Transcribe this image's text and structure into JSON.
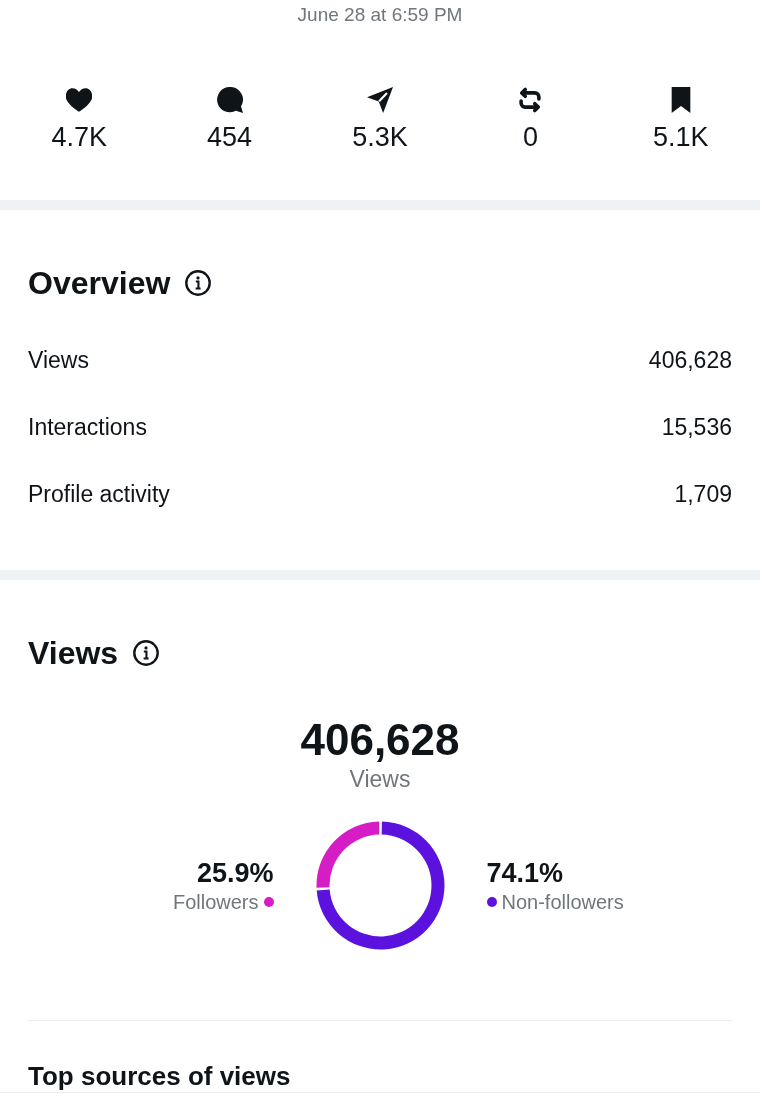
{
  "timestamp": "June 28 at 6:59 PM",
  "stats": [
    {
      "kind": "likes",
      "value": "4.7K"
    },
    {
      "kind": "comments",
      "value": "454"
    },
    {
      "kind": "shares",
      "value": "5.3K"
    },
    {
      "kind": "reposts",
      "value": "0"
    },
    {
      "kind": "saves",
      "value": "5.1K"
    }
  ],
  "overview": {
    "title": "Overview",
    "rows": [
      {
        "label": "Views",
        "value": "406,628"
      },
      {
        "label": "Interactions",
        "value": "15,536"
      },
      {
        "label": "Profile activity",
        "value": "1,709"
      }
    ]
  },
  "views": {
    "title": "Views",
    "total": "406,628",
    "total_label": "Views",
    "chart_data": {
      "type": "donut",
      "categories": [
        "Followers",
        "Non-followers"
      ],
      "values": [
        25.9,
        74.1
      ],
      "colors": [
        "#d61cc4",
        "#5b12df"
      ],
      "value_labels": [
        "25.9%",
        "74.1%"
      ]
    }
  },
  "top_sources": {
    "title": "Top sources of views"
  }
}
